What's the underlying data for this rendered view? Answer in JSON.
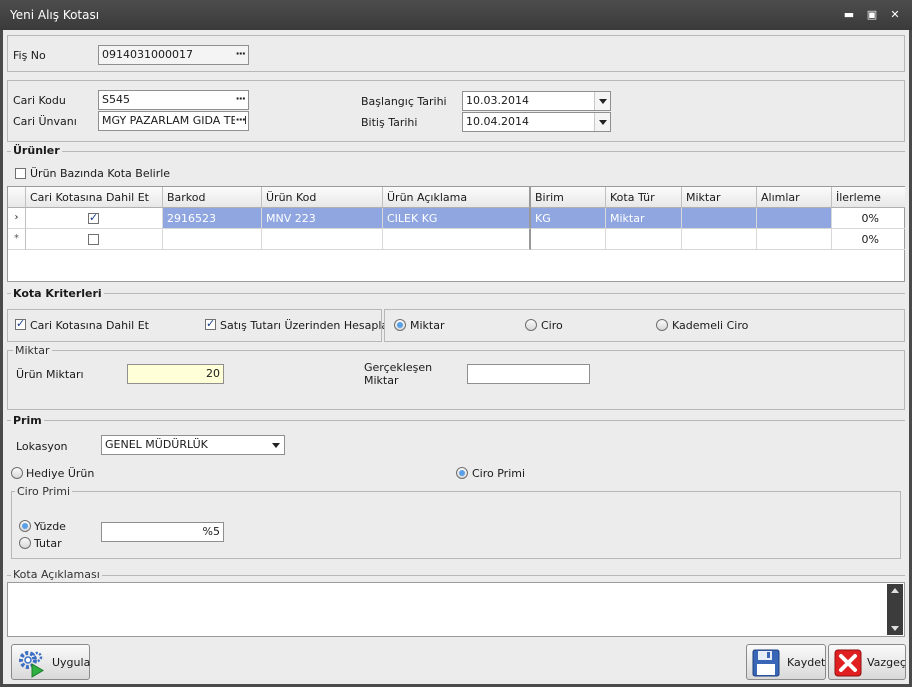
{
  "window": {
    "title": "Yeni Alış Kotası",
    "minimize": "▬",
    "maximize": "▣",
    "close": "✕"
  },
  "header": {
    "fis_no_label": "Fiş No",
    "fis_no_value": "0914031000017"
  },
  "cari": {
    "kodu_label": "Cari Kodu",
    "kodu_value": "S545",
    "unvan_label": "Cari Ünvanı",
    "unvan_value": "MGY PAZARLAM GIDA TEM",
    "baslangic_label": "Başlangıç Tarihi",
    "baslangic_value": "10.03.2014",
    "bitis_label": "Bitiş Tarihi",
    "bitis_value": "10.04.2014"
  },
  "urunler": {
    "title": "Ürünler",
    "urun_bazinda_label": "Ürün Bazında Kota Belirle",
    "columns": [
      "Cari Kotasına Dahil Et",
      "Barkod",
      "Ürün Kod",
      "Ürün Açıklama",
      "Birim",
      "Kota Tür",
      "Miktar",
      "Alımlar",
      "İlerleme"
    ],
    "rows": [
      {
        "indicator": "›",
        "cari_kota": true,
        "barkod": "2916523",
        "urun_kod": "MNV 223",
        "aciklama": "CILEK  KG",
        "birim": "KG",
        "kota_tur": "Miktar",
        "miktar": "",
        "alimlar": "",
        "ilerleme": "0%"
      },
      {
        "indicator": "*",
        "cari_kota": false,
        "barkod": "",
        "urun_kod": "",
        "aciklama": "",
        "birim": "",
        "kota_tur": "",
        "miktar": "",
        "alimlar": "",
        "ilerleme": "0%"
      }
    ]
  },
  "kota_kriterleri": {
    "title": "Kota Kriterleri",
    "cari_kotasina_label": "Cari Kotasına Dahil Et",
    "satis_tutari_label": "Satış Tutarı Üzerinden Hesapla",
    "miktar_radio": "Miktar",
    "ciro_radio": "Ciro",
    "kademeli_radio": "Kademeli Ciro"
  },
  "miktar": {
    "title": "Miktar",
    "urun_miktari_label": "Ürün Miktarı",
    "urun_miktari_value": "20",
    "gerceklesen_label_1": "Gerçekleşen",
    "gerceklesen_label_2": "Miktar",
    "gerceklesen_value": ""
  },
  "prim": {
    "title": "Prim",
    "lokasyon_label": "Lokasyon",
    "lokasyon_value": "GENEL MÜDÜRLÜK",
    "hediye_radio": "Hediye Ürün",
    "ciro_primi_radio": "Ciro Primi",
    "ciro_primi_title": "Ciro Primi",
    "yuzde_radio": "Yüzde",
    "tutar_radio": "Tutar",
    "oran_value": "%5"
  },
  "aciklama": {
    "title": "Kota Açıklaması",
    "value": ""
  },
  "buttons": {
    "uygula": "Uygula",
    "kaydet": "Kaydet",
    "vazgec": "Vazgeç"
  },
  "colors": {
    "selection": "#8fa6e0",
    "title_bar": "#3f3f3f",
    "input_highlight": "#ffffd8"
  }
}
